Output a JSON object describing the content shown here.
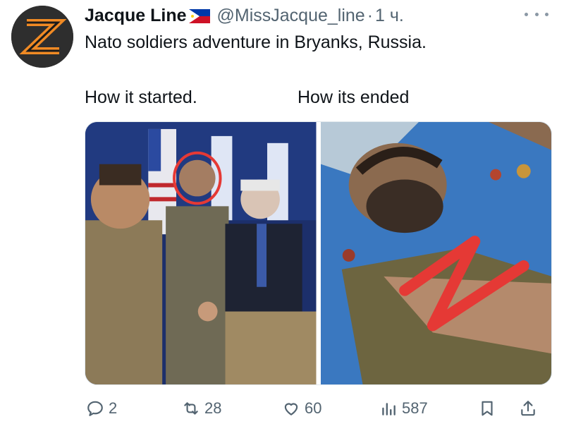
{
  "tweet": {
    "display_name": "Jacque Line",
    "flag_icon": "philippines-flag-icon",
    "handle": "@MissJacque_line",
    "separator": "·",
    "time": "1 ч.",
    "text": "Nato soldiers adventure in Bryanks, Russia.",
    "caption_left": "How it started.",
    "caption_right": "How its ended",
    "more_icon": "more-icon"
  },
  "actions": {
    "reply": {
      "icon": "reply-icon",
      "count": "2"
    },
    "retweet": {
      "icon": "retweet-icon",
      "count": "28"
    },
    "like": {
      "icon": "heart-icon",
      "count": "60"
    },
    "views": {
      "icon": "views-icon",
      "count": "587"
    },
    "bookmark": {
      "icon": "bookmark-icon"
    },
    "share": {
      "icon": "share-icon"
    }
  },
  "colors": {
    "text": "#0f1419",
    "secondary": "#536471",
    "highlight_red": "#e53935"
  }
}
